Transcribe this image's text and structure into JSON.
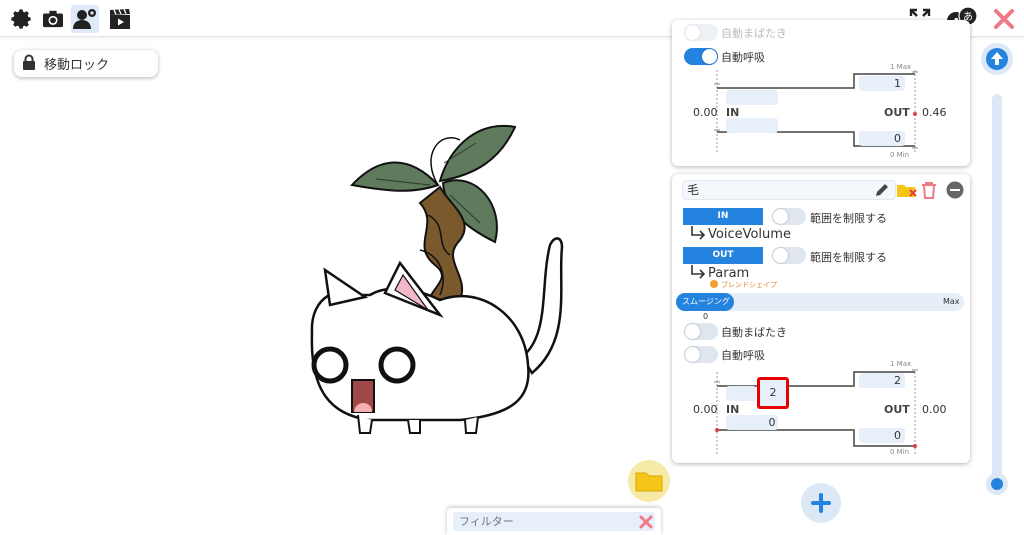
{
  "toolbar": {
    "icons": [
      "gear-icon",
      "camera-icon",
      "user-settings-icon",
      "clapperboard-icon"
    ],
    "right_icons": [
      "fullscreen-icon",
      "language-icon",
      "close-icon"
    ],
    "language_glyph_a": "A",
    "language_glyph_b": "あ"
  },
  "lock_button": {
    "label": "移動ロック"
  },
  "panel_top": {
    "partial_label": "自動まばたき",
    "breath_label": "自動呼吸",
    "breath_on": true,
    "max_label": "1 Max",
    "min_label": "0 Min",
    "out_top_value": "1",
    "out_bottom_value": "0",
    "in_value_left": "0.00",
    "in_label": "IN",
    "out_label": "OUT",
    "out_value_right": "0.46"
  },
  "panel_main": {
    "name_value": "毛",
    "in_button": "IN",
    "in_limit_label": "範囲を制限する",
    "in_param": "VoiceVolume",
    "out_button": "OUT",
    "out_limit_label": "範囲を制限する",
    "out_param": "Param",
    "blend_shape_label": "ブレンドシェイプ",
    "smoothing_label": "スムージング",
    "smoothing_max": "Max",
    "smoothing_value": "0",
    "blink_label": "自動まばたき",
    "breath_label": "自動呼吸",
    "max_label": "1 Max",
    "min_label": "0 Min",
    "out_top_value": "2",
    "in_top_value": "2",
    "in_bottom_value": "0",
    "out_bottom_value": "0",
    "in_value_left": "0.00",
    "in_label": "IN",
    "out_label": "OUT",
    "out_value_right": "0.00"
  },
  "filter": {
    "placeholder": "フィルター"
  },
  "colors": {
    "accent": "#2583e0",
    "danger": "#f07a84",
    "highlight": "#e60000",
    "folder": "#f5c518"
  }
}
